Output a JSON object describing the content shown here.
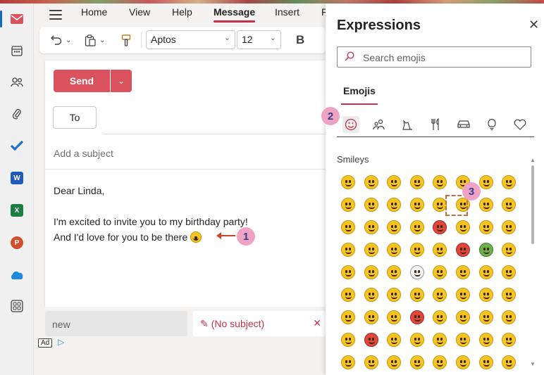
{
  "ribbon": {
    "tabs": [
      "Home",
      "View",
      "Help",
      "Message",
      "Insert",
      "F"
    ],
    "active_tab": "Message"
  },
  "toolbar": {
    "font_name": "Aptos",
    "font_size": "12",
    "bold_label": "B"
  },
  "compose": {
    "send_label": "Send",
    "to_label": "To",
    "subject_placeholder": "Add a subject",
    "body_lines": [
      "Dear Linda,",
      "I'm excited to invite you to my birthday party!",
      "And I'd love for you to be there"
    ]
  },
  "drafts": {
    "new_label": "new",
    "current_label": "(No subject)",
    "ad_label": "Ad"
  },
  "expressions": {
    "title": "Expressions",
    "search_placeholder": "Search emojis",
    "tab_label": "Emojis",
    "section_label": "Smileys",
    "categories": [
      "smiley-icon",
      "people-icon",
      "animals-icon",
      "food-icon",
      "travel-icon",
      "objects-icon",
      "symbols-icon"
    ]
  },
  "annotations": [
    "1",
    "2",
    "3"
  ],
  "colors": {
    "accent": "#c4314b",
    "send": "#d9525e",
    "badge": "#efa3c4",
    "emoji_yellow": "#f7c325"
  }
}
